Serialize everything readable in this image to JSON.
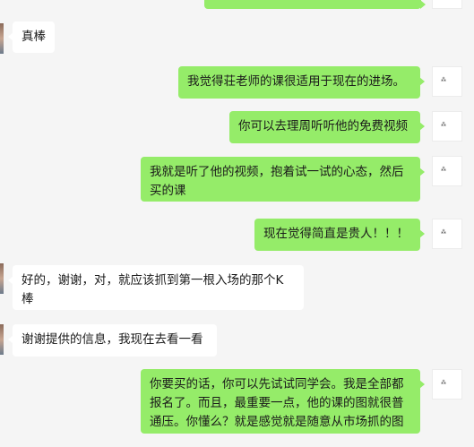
{
  "chat": {
    "messages": [
      {
        "side": "in",
        "text": "真棒"
      },
      {
        "side": "out",
        "text": "我觉得荘老师的课很适用于现在的进场。"
      },
      {
        "side": "out",
        "text": "你可以去理周听听他的免费视频"
      },
      {
        "side": "out",
        "text": "我就是听了他的视频，抱着试一试的心态，然后买的课"
      },
      {
        "side": "out",
        "text": "现在觉得简直是贵人！！！"
      },
      {
        "side": "in",
        "text": "好的，谢谢，对，就应该抓到第一根入场的那个K棒"
      },
      {
        "side": "in",
        "text": "谢谢提供的信息，我现在去看一看"
      },
      {
        "side": "out",
        "text": "你要买的话，你可以先试试同学会。我是全部都报名了。而且，最重要一点，他的课的图就很普通压。你懂么？就是感觉就是随意从市场抓的图"
      }
    ]
  }
}
